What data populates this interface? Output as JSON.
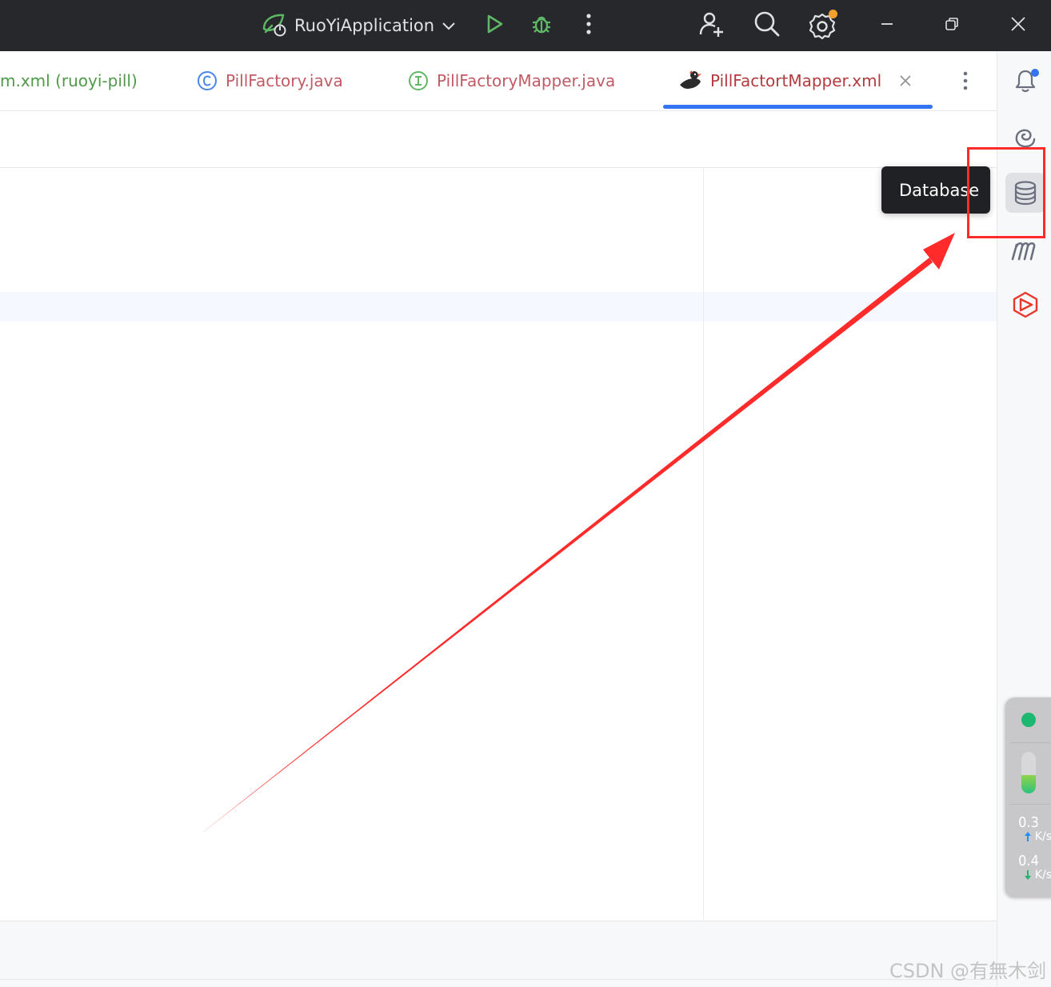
{
  "titlebar": {
    "run_config_label": "RuoYiApplication",
    "icons": [
      "spring-boot-icon",
      "chevron-down-icon",
      "run-icon",
      "debug-icon",
      "more-vertical-icon",
      "add-user-icon",
      "search-icon",
      "settings-icon",
      "minimize-icon",
      "restore-icon",
      "close-icon"
    ],
    "colors": {
      "background": "#27282c",
      "run_green": "#5fb865",
      "settings_badge": "#f2a12b"
    }
  },
  "tabs": [
    {
      "label": "m.xml (ruoyi-pill)",
      "icon": "",
      "color": "#4f9a48",
      "active": false
    },
    {
      "label": "PillFactory.java",
      "icon": "class-icon",
      "color": "#c05a64",
      "active": false
    },
    {
      "label": "PillFactoryMapper.java",
      "icon": "interface-icon",
      "color": "#c05a64",
      "active": false
    },
    {
      "label": "PillFactortMapper.xml",
      "icon": "mybatis-bird-icon",
      "color": "#b33b3f",
      "active": true
    }
  ],
  "tab_actions": {
    "close_icon": "close-icon",
    "more_icon": "more-vertical-icon"
  },
  "right_rail": {
    "items": [
      "notifications-icon",
      "ai-assistant-icon",
      "database-icon",
      "maven-icon",
      "plugin-icon"
    ],
    "active": "database-icon",
    "tooltip": "Database"
  },
  "net_monitor": {
    "status_color": "#1eb770",
    "level": 0.45,
    "upload": {
      "value": "0.3",
      "unit": "K/s"
    },
    "download": {
      "value": "0.4",
      "unit": "K/s"
    }
  },
  "annotation": {
    "color": "#ff2a2a"
  },
  "watermark": "CSDN @有無木剑"
}
